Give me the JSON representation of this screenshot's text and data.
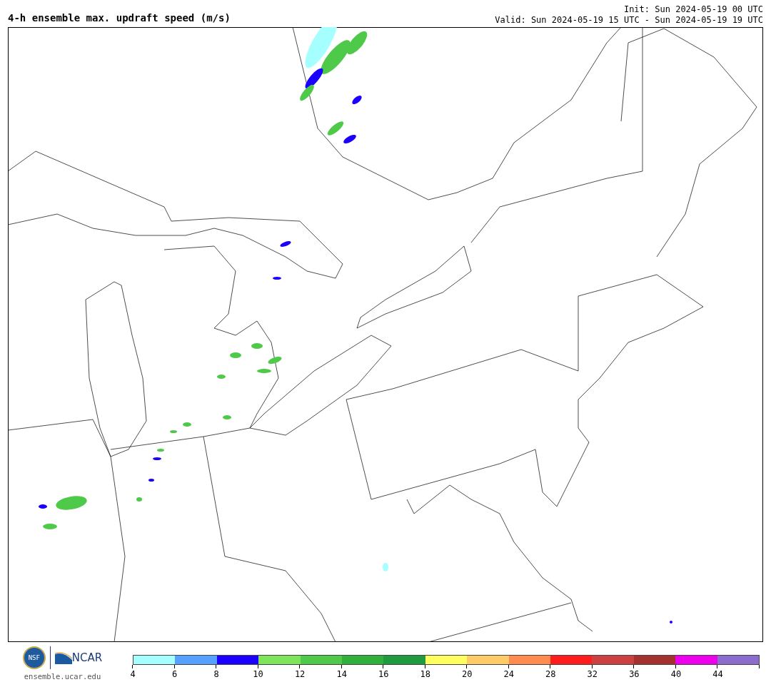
{
  "title": "4-h ensemble max. updraft speed (m/s)",
  "init": "Init: Sun 2024-05-19 00 UTC",
  "valid": "Valid: Sun 2024-05-19 15 UTC - Sun 2024-05-19 19 UTC",
  "logos": {
    "nsf": "NSF",
    "ncar": "NCAR",
    "website": "ensemble.ucar.edu"
  },
  "colorbar": {
    "segments": [
      {
        "label": "4",
        "color": "#a6ffff"
      },
      {
        "label": "6",
        "color": "#56a0ff"
      },
      {
        "label": "8",
        "color": "#1c00ff"
      },
      {
        "label": "10",
        "color": "#7ee55a"
      },
      {
        "label": "12",
        "color": "#4ec94a"
      },
      {
        "label": "14",
        "color": "#30af3a"
      },
      {
        "label": "16",
        "color": "#209a3f"
      },
      {
        "label": "18",
        "color": "#ffff5e"
      },
      {
        "label": "20",
        "color": "#ffcb66"
      },
      {
        "label": "24",
        "color": "#ff8c4e"
      },
      {
        "label": "28",
        "color": "#ff1c1c"
      },
      {
        "label": "32",
        "color": "#cc4040"
      },
      {
        "label": "36",
        "color": "#a53030"
      },
      {
        "label": "40",
        "color": "#ee00ee"
      },
      {
        "label": "44",
        "color": "#8c6ccc"
      }
    ]
  }
}
